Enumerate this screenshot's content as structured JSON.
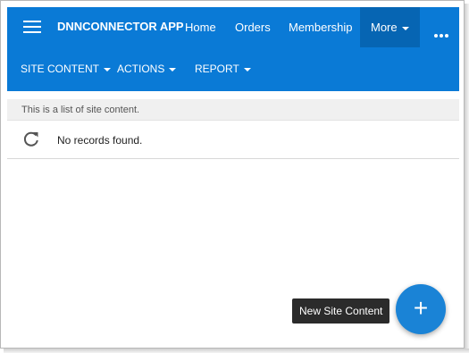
{
  "app": {
    "title": "DNNCONNECTOR APP"
  },
  "nav": {
    "items": [
      {
        "label": "Home"
      },
      {
        "label": "Orders"
      },
      {
        "label": "Membership"
      },
      {
        "label": "More"
      }
    ]
  },
  "subnav": {
    "items": [
      {
        "label": "SITE CONTENT"
      },
      {
        "label": "ACTIONS"
      },
      {
        "label": "REPORT"
      }
    ]
  },
  "content": {
    "description": "This is a list of site content.",
    "empty_message": "No records found."
  },
  "fab": {
    "tooltip": "New Site Content",
    "icon": "plus-icon"
  },
  "icons": {
    "menu": "hamburger-icon",
    "refresh": "refresh-icon",
    "overflow": "more-dots-icon"
  },
  "colors": {
    "accent": "#0a7ad6",
    "accent_dark": "#0665b3",
    "fab": "#1a83d6"
  }
}
